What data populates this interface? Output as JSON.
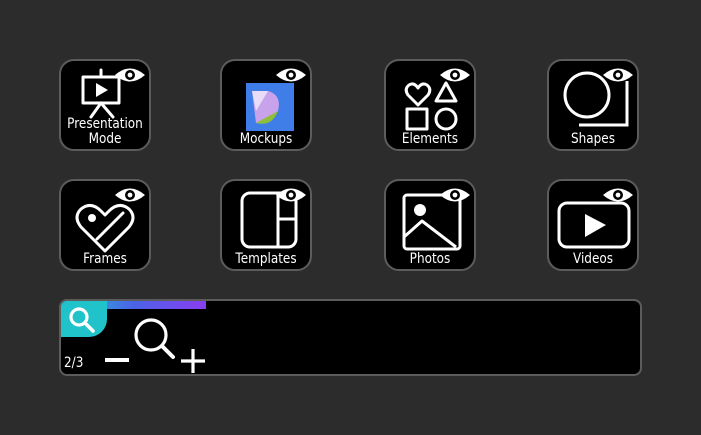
{
  "tiles": [
    {
      "id": "presentation-mode",
      "label": "Presentation\nMode",
      "icon": "presentation-easel-icon"
    },
    {
      "id": "mockups",
      "label": "Mockups",
      "icon": "mockups-icon"
    },
    {
      "id": "elements",
      "label": "Elements",
      "icon": "elements-shapes-icon"
    },
    {
      "id": "shapes",
      "label": "Shapes",
      "icon": "shapes-icon"
    },
    {
      "id": "frames",
      "label": "Frames",
      "icon": "frames-heart-icon"
    },
    {
      "id": "templates",
      "label": "Templates",
      "icon": "templates-icon"
    },
    {
      "id": "photos",
      "label": "Photos",
      "icon": "photos-icon"
    },
    {
      "id": "videos",
      "label": "Videos",
      "icon": "videos-play-icon"
    }
  ],
  "zoom": {
    "page_indicator": "2/3",
    "progress_fraction": 0.25,
    "accent_color": "#1fc3c9",
    "icons": [
      "search-icon",
      "minus-icon",
      "zoom-lens-icon",
      "plus-icon"
    ]
  },
  "colors": {
    "background": "#2c2c2c",
    "tile": "#000000",
    "tile_border": "#5c5c5c",
    "foreground": "#ffffff"
  }
}
